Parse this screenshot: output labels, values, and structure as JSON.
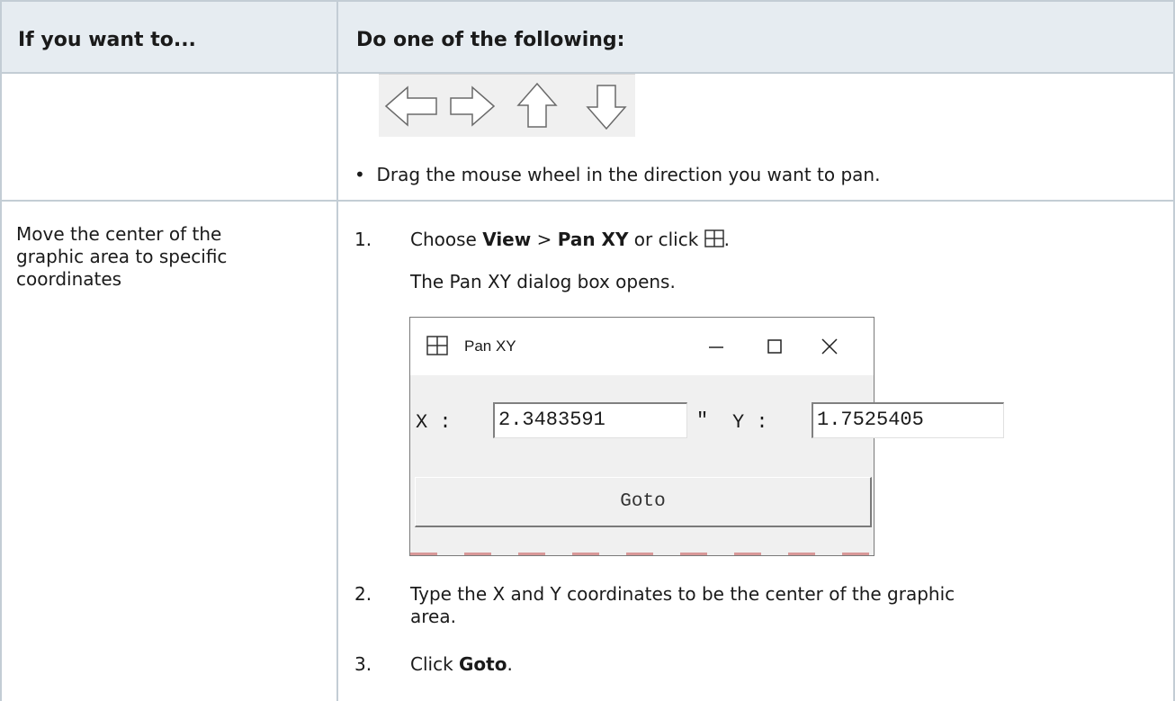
{
  "table": {
    "headers": [
      "If you want to...",
      "Do one of the following:"
    ],
    "row1": {
      "arrow_icons": [
        "left-arrow-icon",
        "right-arrow-icon",
        "up-arrow-icon",
        "down-arrow-icon"
      ],
      "bullet": "Drag the mouse wheel in the direction you want to pan."
    },
    "row2": {
      "left_lines": [
        "Move the center of the",
        "graphic area to specific",
        "coordinates"
      ],
      "steps": [
        {
          "num": "1.",
          "pre": "Choose ",
          "b1": "View",
          "mid": " > ",
          "b2": "Pan XY",
          "post": " or click ",
          "icon": "pan-xy-icon",
          "end": "."
        },
        {
          "num": "",
          "text": "The Pan XY dialog box opens."
        },
        {
          "num": "2.",
          "line1": "Type the X and Y coordinates to be the center of the graphic",
          "line2": "area."
        },
        {
          "num": "3.",
          "pre": "Click ",
          "b1": "Goto",
          "end": "."
        }
      ]
    }
  },
  "dialog": {
    "title": "Pan XY",
    "x_label": "X :",
    "x_value": "2.3483591",
    "x_unit": "\"",
    "y_label": "Y :",
    "y_value": "1.7525405",
    "y_unit": "\"",
    "goto_label": "Goto"
  }
}
